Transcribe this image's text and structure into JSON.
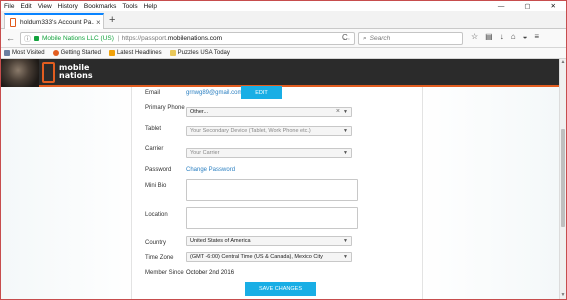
{
  "menu": [
    "File",
    "Edit",
    "View",
    "History",
    "Bookmarks",
    "Tools",
    "Help"
  ],
  "window_controls": {
    "minimize": "—",
    "maximize": "▢",
    "close": "✕"
  },
  "tab": {
    "title": "holdum333's Account Pa...",
    "close": "×"
  },
  "new_tab": "+",
  "nav": {
    "back": "←",
    "info": "ⓘ",
    "org": "Mobile Nations LLC (US)",
    "scheme": "https://passport.",
    "host": "mobilenations.com",
    "page_actions": "⋯",
    "reload": "C",
    "search_placeholder": "Search",
    "search_icon": "⌕"
  },
  "toolbar_icons": [
    "star-icon",
    "reading-list-icon",
    "download-icon",
    "home-icon",
    "pocket-icon",
    "menu-icon"
  ],
  "toolbar_glyphs": [
    "☆",
    "▤",
    "↓",
    "⌂",
    "◒",
    "≡"
  ],
  "bookmarks": [
    {
      "label": "Most Visited",
      "color": "#6b7fa0"
    },
    {
      "label": "Getting Started",
      "color": "#e25d20"
    },
    {
      "label": "Latest Headlines",
      "color": "#f1a20b"
    },
    {
      "label": "Puzzles USA Today",
      "color": "#e8c75a"
    }
  ],
  "site": {
    "logo_line1": "mobile",
    "logo_line2": "nations"
  },
  "form": {
    "email": {
      "label": "Email",
      "value": "grnwg89@gmail.com",
      "edit": "EDIT"
    },
    "primary_phone": {
      "label": "Primary Phone",
      "value": "Other..."
    },
    "tablet": {
      "label": "Tablet",
      "placeholder": "Your Secondary Device (Tablet, Work Phone etc.)"
    },
    "carrier": {
      "label": "Carrier",
      "placeholder": "Your Carrier"
    },
    "password": {
      "label": "Password",
      "link": "Change Password"
    },
    "mini_bio": {
      "label": "Mini Bio"
    },
    "location": {
      "label": "Location"
    },
    "country": {
      "label": "Country",
      "value": "United States of America"
    },
    "time_zone": {
      "label": "Time Zone",
      "value": "(GMT -6:00) Central Time (US & Canada), Mexico City"
    },
    "member_since": {
      "label": "Member Since",
      "value": "October 2nd 2016"
    },
    "save": "SAVE CHANGES"
  },
  "colors": {
    "accent": "#19aee5",
    "brand_orange": "#e25d20",
    "link": "#2a7fc1",
    "secure_green": "#12a23c"
  }
}
